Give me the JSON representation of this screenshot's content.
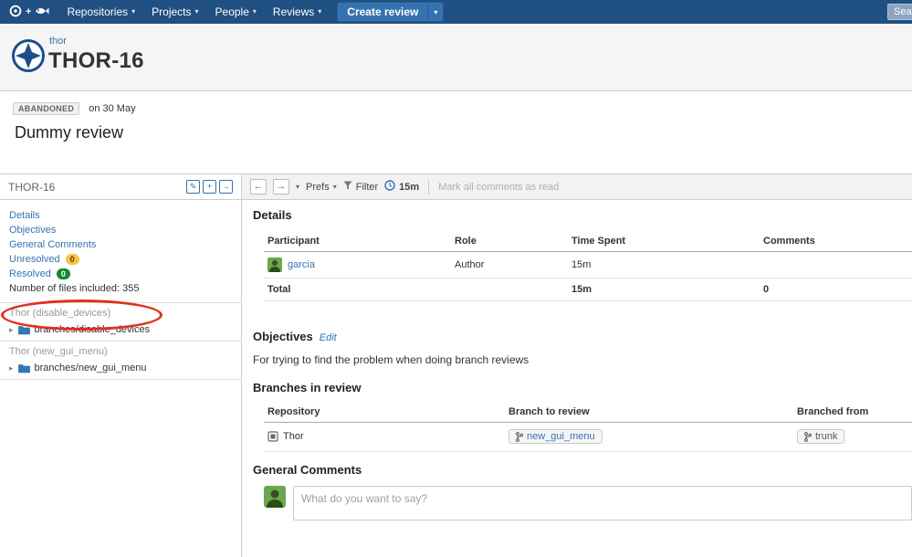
{
  "colors": {
    "nav_bg": "#205081",
    "accent": "#3572b0",
    "unresolved_badge": "#f6c342",
    "resolved_badge": "#14892c",
    "annotation_red": "#e0301e"
  },
  "icons": {
    "edit": "✎",
    "add": "+",
    "expand": "→",
    "caret": "▾",
    "tree_caret": "▸",
    "back": "←",
    "forward": "→",
    "plus": "+"
  },
  "nav": {
    "menus": [
      {
        "label": "Repositories"
      },
      {
        "label": "Projects"
      },
      {
        "label": "People"
      },
      {
        "label": "Reviews"
      }
    ],
    "create_review": "Create review",
    "search_placeholder": "Search"
  },
  "header": {
    "project": "thor",
    "review_key": "THOR-16"
  },
  "status": {
    "badge": "ABANDONED",
    "date": "on 30 May",
    "title": "Dummy review"
  },
  "sidebar": {
    "title": "THOR-16",
    "links": [
      {
        "label": "Details"
      },
      {
        "label": "Objectives"
      },
      {
        "label": "General Comments"
      },
      {
        "label": "Unresolved",
        "count": "0"
      },
      {
        "label": "Resolved",
        "count": "0"
      }
    ],
    "files_note": "Number of files included: 355",
    "groups": [
      {
        "header": "Thor (disable_devices)",
        "item": "branches/disable_devices"
      },
      {
        "header": "Thor (new_gui_menu)",
        "item": "branches/new_gui_menu"
      }
    ]
  },
  "toolbar": {
    "prefs": "Prefs",
    "filter": "Filter",
    "time": "15m",
    "mark_read": "Mark all comments as read"
  },
  "details": {
    "heading": "Details",
    "columns": [
      "Participant",
      "Role",
      "Time Spent",
      "Comments"
    ],
    "rows": [
      {
        "participant": "garcia",
        "role": "Author",
        "time": "15m",
        "comments": ""
      }
    ],
    "total": {
      "label": "Total",
      "time": "15m",
      "comments": "0"
    }
  },
  "objectives": {
    "heading": "Objectives",
    "edit": "Edit",
    "text": "For trying to find the problem when doing branch reviews"
  },
  "branches": {
    "heading": "Branches in review",
    "columns": [
      "Repository",
      "Branch to review",
      "Branched from"
    ],
    "rows": [
      {
        "repository": "Thor",
        "branch": "new_gui_menu",
        "from": "trunk"
      }
    ]
  },
  "comments": {
    "heading": "General Comments",
    "placeholder": "What do you want to say?"
  }
}
